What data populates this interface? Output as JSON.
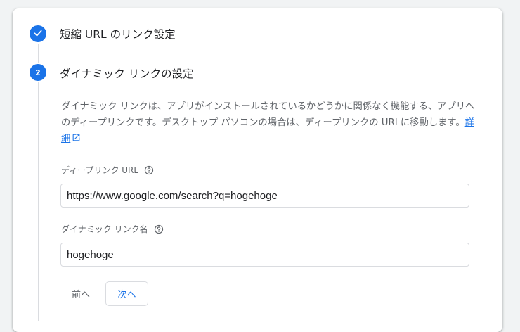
{
  "steps": [
    {
      "number": "",
      "title": "短縮 URL のリンク設定",
      "status": "complete",
      "icon": "check-icon"
    },
    {
      "number": "2",
      "title": "ダイナミック リンクの設定",
      "status": "active"
    }
  ],
  "description": {
    "text": "ダイナミック リンクは、アプリがインストールされているかどうかに関係なく機能する、アプリへのディープリンクです。デスクトップ パソコンの場合は、ディープリンクの URI に移動します。",
    "link_label": "詳細",
    "link_icon": "external-link-icon"
  },
  "fields": {
    "deep_link": {
      "label": "ディープリンク URL",
      "value": "https://www.google.com/search?q=hogehoge",
      "help_icon": "help-circle-icon"
    },
    "link_name": {
      "label": "ダイナミック リンク名",
      "value": "hogehoge",
      "help_icon": "help-circle-icon"
    }
  },
  "buttons": {
    "prev_label": "前へ",
    "next_label": "次へ"
  },
  "colors": {
    "accent": "#1a73e8",
    "secondary_text": "#5f6368",
    "border": "#dadce0",
    "background": "#f1f3f4"
  }
}
